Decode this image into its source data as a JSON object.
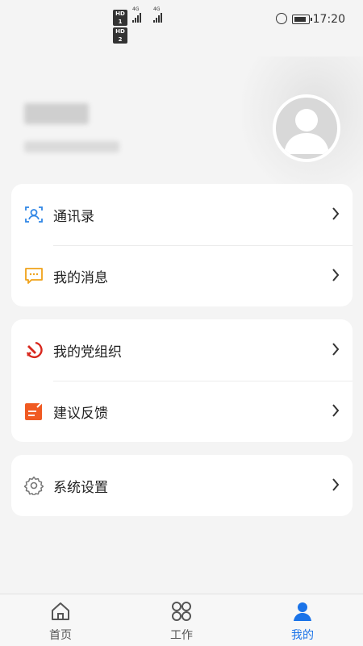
{
  "status_bar": {
    "sim1": "HD 1",
    "sim2": "HD 2",
    "net1": "4G",
    "net2": "4G",
    "time": "17:20"
  },
  "profile": {
    "avatar_icon": "user-avatar-icon"
  },
  "menu_groups": [
    {
      "items": [
        {
          "label": "通讯录",
          "icon": "contacts-icon"
        },
        {
          "label": "我的消息",
          "icon": "message-icon"
        }
      ]
    },
    {
      "items": [
        {
          "label": "我的党组织",
          "icon": "party-emblem-icon"
        },
        {
          "label": "建议反馈",
          "icon": "feedback-icon"
        }
      ]
    },
    {
      "items": [
        {
          "label": "系统设置",
          "icon": "settings-gear-icon"
        }
      ]
    }
  ],
  "tab_bar": {
    "tabs": [
      {
        "label": "首页",
        "icon": "home-icon",
        "active": false
      },
      {
        "label": "工作",
        "icon": "work-grid-icon",
        "active": false
      },
      {
        "label": "我的",
        "icon": "person-icon",
        "active": true
      }
    ]
  },
  "colors": {
    "accent": "#1a73e8",
    "contacts": "#2f86e6",
    "message": "#f0a21a",
    "party": "#d8281e",
    "feedback": "#f05a22"
  }
}
